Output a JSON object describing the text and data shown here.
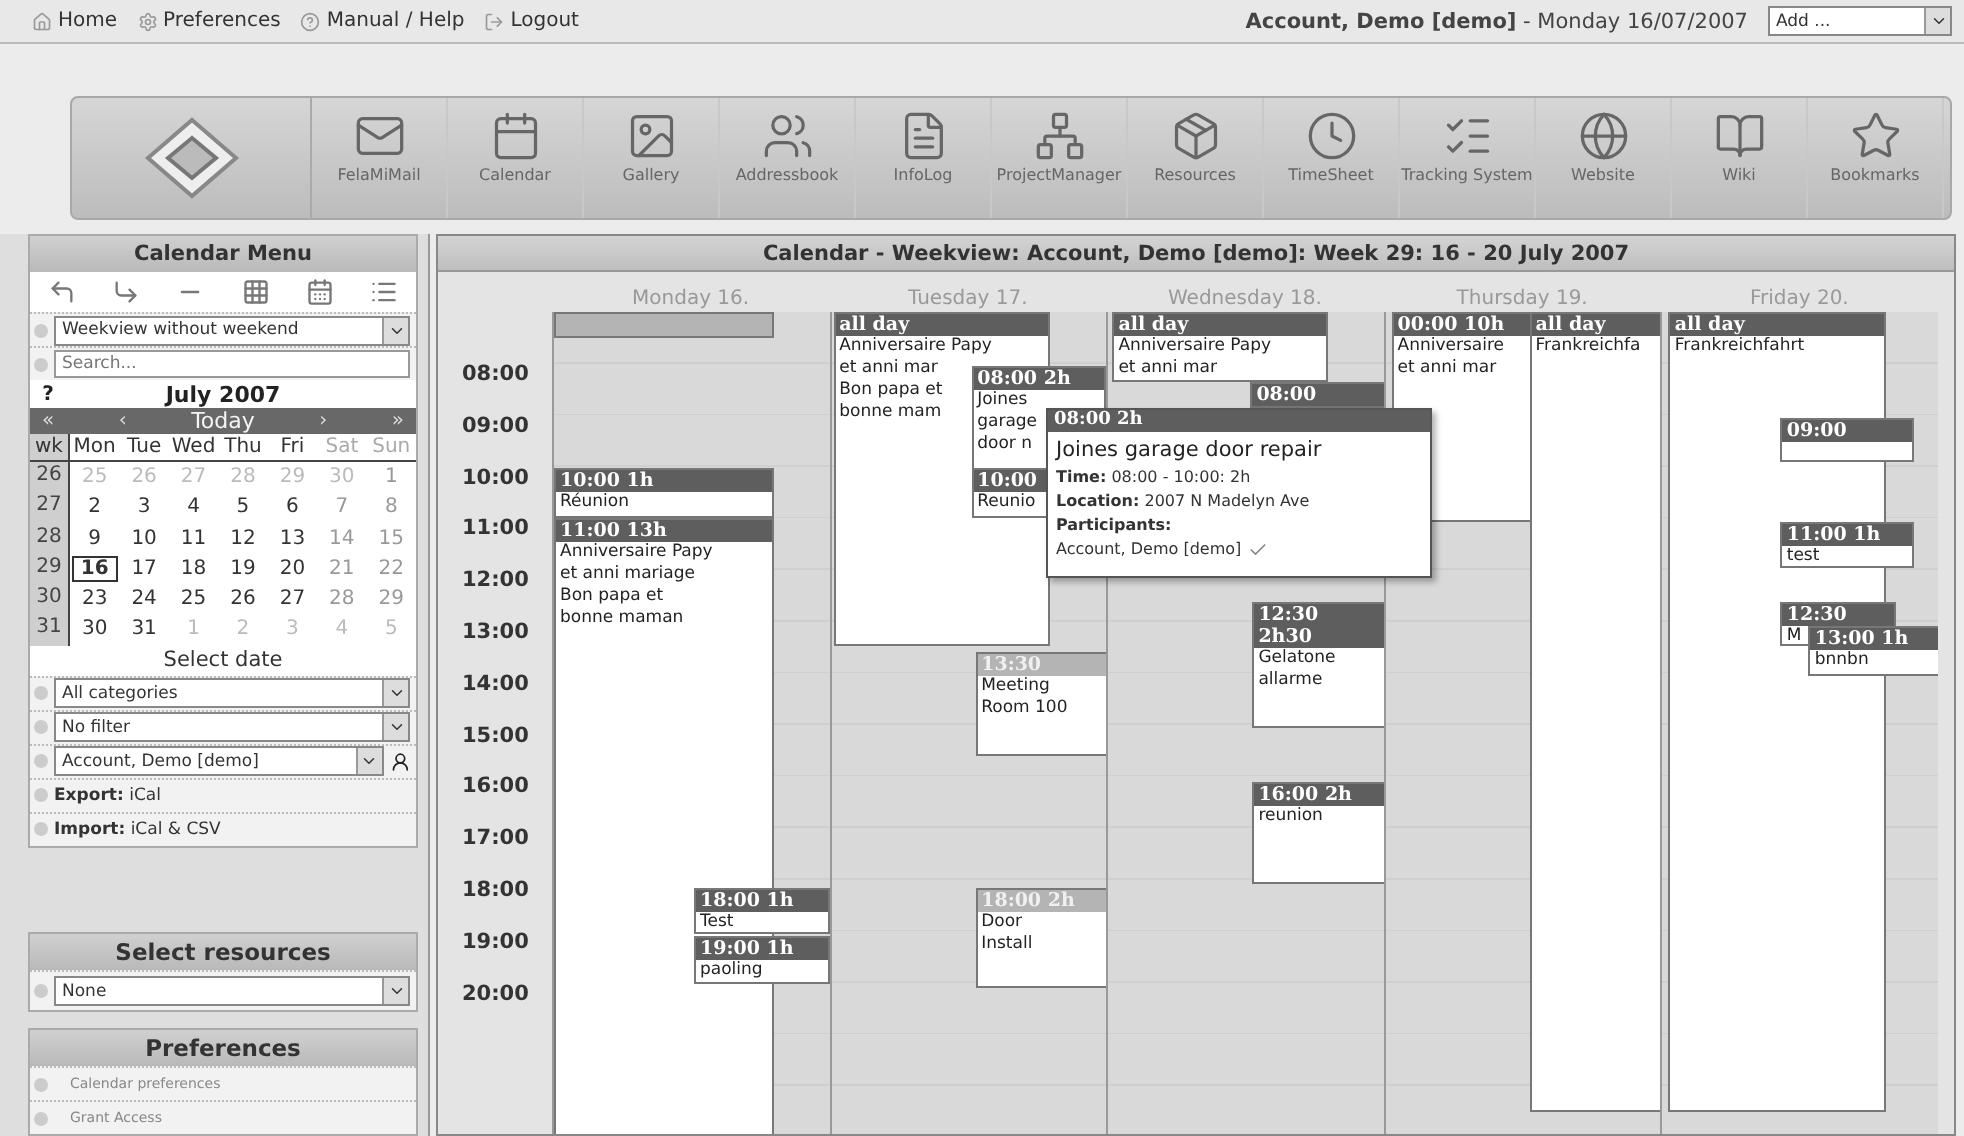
{
  "top_bar": {
    "links": [
      "Home",
      "Preferences",
      "Manual / Help",
      "Logout"
    ],
    "user_line": "**Account, Demo [demo]** - Monday 16/07/2007",
    "add_select": "Add ..."
  },
  "apps": [
    "FelaMiMail",
    "Calendar",
    "Gallery",
    "Addressbook",
    "InfoLog",
    "ProjectManager",
    "Resources",
    "TimeSheet",
    "Tracking System",
    "Website",
    "Wiki",
    "Bookmarks"
  ],
  "sidebar": {
    "calendar_menu": {
      "title": "Calendar Menu",
      "view_select": "Weekview without weekend",
      "search_placeholder": "Search...",
      "help": "?",
      "month": "July 2007",
      "nav": [
        "«",
        "‹",
        "Today",
        "›",
        "»"
      ],
      "weekdays": [
        {
          "text": "wk",
          "kind": "wk"
        },
        {
          "text": "Mon",
          "kind": "day"
        },
        {
          "text": "Tue",
          "kind": "day"
        },
        {
          "text": "Wed",
          "kind": "day"
        },
        {
          "text": "Thu",
          "kind": "day"
        },
        {
          "text": "Fri",
          "kind": "day"
        },
        {
          "text": "Sat",
          "kind": "weekend"
        },
        {
          "text": "Sun",
          "kind": "weekend"
        }
      ],
      "weeks": [
        {
          "wk": "26",
          "days": [
            {
              "d": "25",
              "kind": "other"
            },
            {
              "d": "26",
              "kind": "other"
            },
            {
              "d": "27",
              "kind": "other"
            },
            {
              "d": "28",
              "kind": "other"
            },
            {
              "d": "29",
              "kind": "other"
            },
            {
              "d": "30",
              "kind": "other"
            },
            {
              "d": "1",
              "kind": "weekend"
            }
          ]
        },
        {
          "wk": "27",
          "days": [
            {
              "d": "2",
              "kind": "day"
            },
            {
              "d": "3",
              "kind": "day"
            },
            {
              "d": "4",
              "kind": "day"
            },
            {
              "d": "5",
              "kind": "day"
            },
            {
              "d": "6",
              "kind": "day"
            },
            {
              "d": "7",
              "kind": "weekend"
            },
            {
              "d": "8",
              "kind": "weekend"
            }
          ]
        },
        {
          "wk": "28",
          "days": [
            {
              "d": "9",
              "kind": "day"
            },
            {
              "d": "10",
              "kind": "day"
            },
            {
              "d": "11",
              "kind": "day"
            },
            {
              "d": "12",
              "kind": "day"
            },
            {
              "d": "13",
              "kind": "day"
            },
            {
              "d": "14",
              "kind": "weekend"
            },
            {
              "d": "15",
              "kind": "weekend"
            }
          ]
        },
        {
          "wk": "29",
          "days": [
            {
              "d": "16",
              "kind": "today"
            },
            {
              "d": "17",
              "kind": "day"
            },
            {
              "d": "18",
              "kind": "day"
            },
            {
              "d": "19",
              "kind": "day"
            },
            {
              "d": "20",
              "kind": "day"
            },
            {
              "d": "21",
              "kind": "weekend"
            },
            {
              "d": "22",
              "kind": "weekend"
            }
          ]
        },
        {
          "wk": "30",
          "days": [
            {
              "d": "23",
              "kind": "day"
            },
            {
              "d": "24",
              "kind": "day"
            },
            {
              "d": "25",
              "kind": "day"
            },
            {
              "d": "26",
              "kind": "day"
            },
            {
              "d": "27",
              "kind": "day"
            },
            {
              "d": "28",
              "kind": "weekend"
            },
            {
              "d": "29",
              "kind": "weekend"
            }
          ]
        },
        {
          "wk": "31",
          "days": [
            {
              "d": "30",
              "kind": "day"
            },
            {
              "d": "31",
              "kind": "day"
            },
            {
              "d": "1",
              "kind": "other"
            },
            {
              "d": "2",
              "kind": "other"
            },
            {
              "d": "3",
              "kind": "other"
            },
            {
              "d": "4",
              "kind": "other"
            },
            {
              "d": "5",
              "kind": "other"
            }
          ]
        }
      ],
      "select_date": "Select date",
      "filters": [
        {
          "kind": "select",
          "value": "All categories"
        },
        {
          "kind": "select",
          "value": "No filter"
        },
        {
          "kind": "user_select",
          "value": "Account, Demo [demo]"
        },
        {
          "kind": "link",
          "label": "Export:",
          "value": "iCal"
        },
        {
          "kind": "link",
          "label": "Import:",
          "value": "iCal & CSV"
        }
      ]
    },
    "resources": {
      "title": "Select resources",
      "value": "None"
    },
    "preferences": {
      "title": "Preferences",
      "items": [
        "Calendar preferences",
        "Grant Access"
      ]
    }
  },
  "calendar": {
    "title": "Calendar - Weekview: Account, Demo [demo]: Week 29: 16 - 20 July 2007",
    "times": [
      "08:00",
      "09:00",
      "10:00",
      "11:00",
      "12:00",
      "13:00",
      "14:00",
      "15:00",
      "16:00",
      "17:00",
      "18:00",
      "19:00",
      "20:00"
    ],
    "days": [
      {
        "label": "Monday 16.",
        "events": [
          {
            "kind": "light"
          },
          {
            "kind": "dark",
            "header": "10:00 1h",
            "lines": [
              "Réunion"
            ]
          },
          {
            "kind": "dark",
            "header": "11:00 13h",
            "lines": [
              "Anniversaire Papy",
              "et anni mariage",
              "Bon papa et",
              "bonne maman"
            ]
          },
          {
            "kind": "dark",
            "header": "18:00 1h",
            "lines": [
              "Test"
            ]
          },
          {
            "kind": "dark",
            "header": "19:00 1h",
            "lines": [
              "paoling"
            ]
          }
        ]
      },
      {
        "label": "Tuesday 17.",
        "events": [
          {
            "kind": "dark",
            "header": "all day",
            "lines": [
              "Anniversaire Papy",
              "et anni mar",
              "Bon papa et",
              "bonne mam"
            ]
          },
          {
            "kind": "dark",
            "header": "08:00 2h",
            "lines": [
              "Joines",
              "garage",
              "door n"
            ]
          },
          {
            "kind": "dark",
            "header": "10:00",
            "lines": [
              "Reunio"
            ]
          },
          {
            "kind": "light",
            "header": "13:30",
            "lines": [
              "Meeting",
              "Room 100"
            ]
          },
          {
            "kind": "light",
            "header": "18:00 2h",
            "lines": [
              "Door",
              "Install"
            ]
          }
        ]
      },
      {
        "label": "Wednesday 18.",
        "events": [
          {
            "kind": "dark",
            "header": "all day",
            "lines": [
              "Anniversaire Papy",
              "et anni mar"
            ]
          },
          {
            "kind": "dark",
            "header": "08:00"
          },
          {
            "kind": "dark",
            "header": "12:30\n2h30",
            "lines": [
              "Gelatone",
              "allarme"
            ]
          },
          {
            "kind": "dark",
            "header": "16:00 2h",
            "lines": [
              "reunion"
            ]
          }
        ]
      },
      {
        "label": "Thursday 19.",
        "events": [
          {
            "kind": "dark",
            "header": "00:00 10h",
            "lines": [
              "Anniversaire",
              "et anni mar"
            ]
          },
          {
            "kind": "dark",
            "header": "all day",
            "lines": [
              "Frankreichfa"
            ]
          }
        ]
      },
      {
        "label": "Friday 20.",
        "events": [
          {
            "kind": "dark",
            "header": "all day",
            "lines": [
              "Frankreichfahrt"
            ]
          },
          {
            "kind": "dark",
            "header": "09:00"
          },
          {
            "kind": "dark",
            "header": "11:00 1h",
            "lines": [
              "test"
            ]
          },
          {
            "kind": "dark",
            "header": "12:30",
            "lines": [
              "M"
            ]
          },
          {
            "kind": "dark",
            "header": "13:00 1h",
            "lines": [
              "bnnbn"
            ]
          }
        ]
      }
    ],
    "tooltip": {
      "header": "08:00 2h",
      "title": "Joines garage door repair",
      "lines": [
        "**Time:** 08:00 - 10:00: 2h",
        "**Location:** 2007 N Madelyn Ave",
        "**Participants:**",
        "Account, Demo [demo]"
      ]
    }
  }
}
